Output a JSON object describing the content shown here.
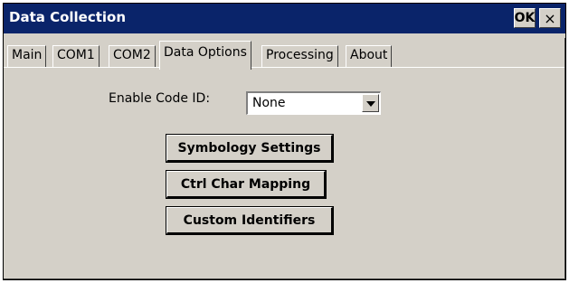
{
  "window": {
    "title": "Data Collection",
    "ok_label": "OK",
    "close_label": "×"
  },
  "tabs": [
    {
      "label": "Main",
      "active": false
    },
    {
      "label": "COM1",
      "active": false
    },
    {
      "label": "COM2",
      "active": false
    },
    {
      "label": "Data Options",
      "active": true
    },
    {
      "label": "Processing",
      "active": false
    },
    {
      "label": "About",
      "active": false
    }
  ],
  "data_options": {
    "enable_code_id_label": "Enable Code ID:",
    "enable_code_id_value": "None",
    "buttons": {
      "symbology": "Symbology Settings",
      "ctrl_char": "Ctrl Char Mapping",
      "custom_ids": "Custom Identifiers"
    }
  },
  "colors": {
    "titlebar": "#0a246a",
    "face": "#d4d0c8"
  }
}
